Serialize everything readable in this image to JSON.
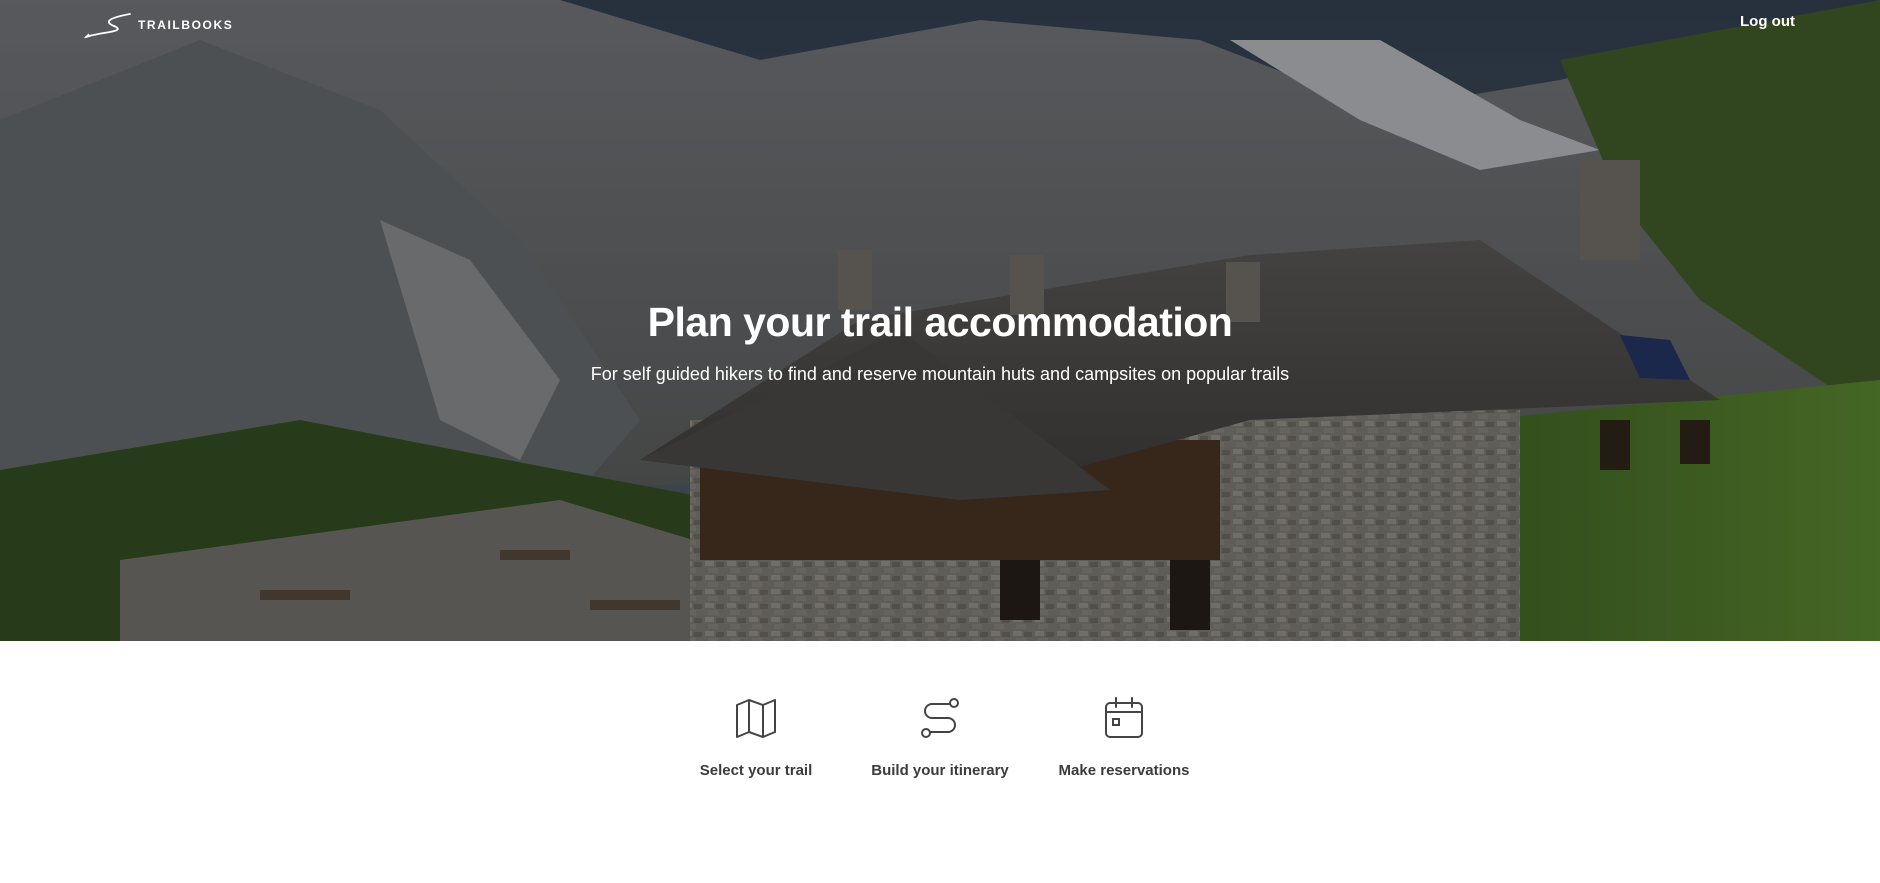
{
  "brand": {
    "name": "TRAILBOOKS"
  },
  "nav": {
    "logout_label": "Log out"
  },
  "hero": {
    "title": "Plan your trail accommodation",
    "subtitle": "For self guided hikers to find and reserve mountain huts and campsites on popular trails"
  },
  "steps": [
    {
      "icon": "map-icon",
      "label": "Select your trail"
    },
    {
      "icon": "route-icon",
      "label": "Build your itinerary"
    },
    {
      "icon": "calendar-icon",
      "label": "Make reservations"
    }
  ],
  "colors": {
    "hero_text": "#ffffff",
    "step_text": "#3c3c3c",
    "step_icon": "#444444"
  }
}
